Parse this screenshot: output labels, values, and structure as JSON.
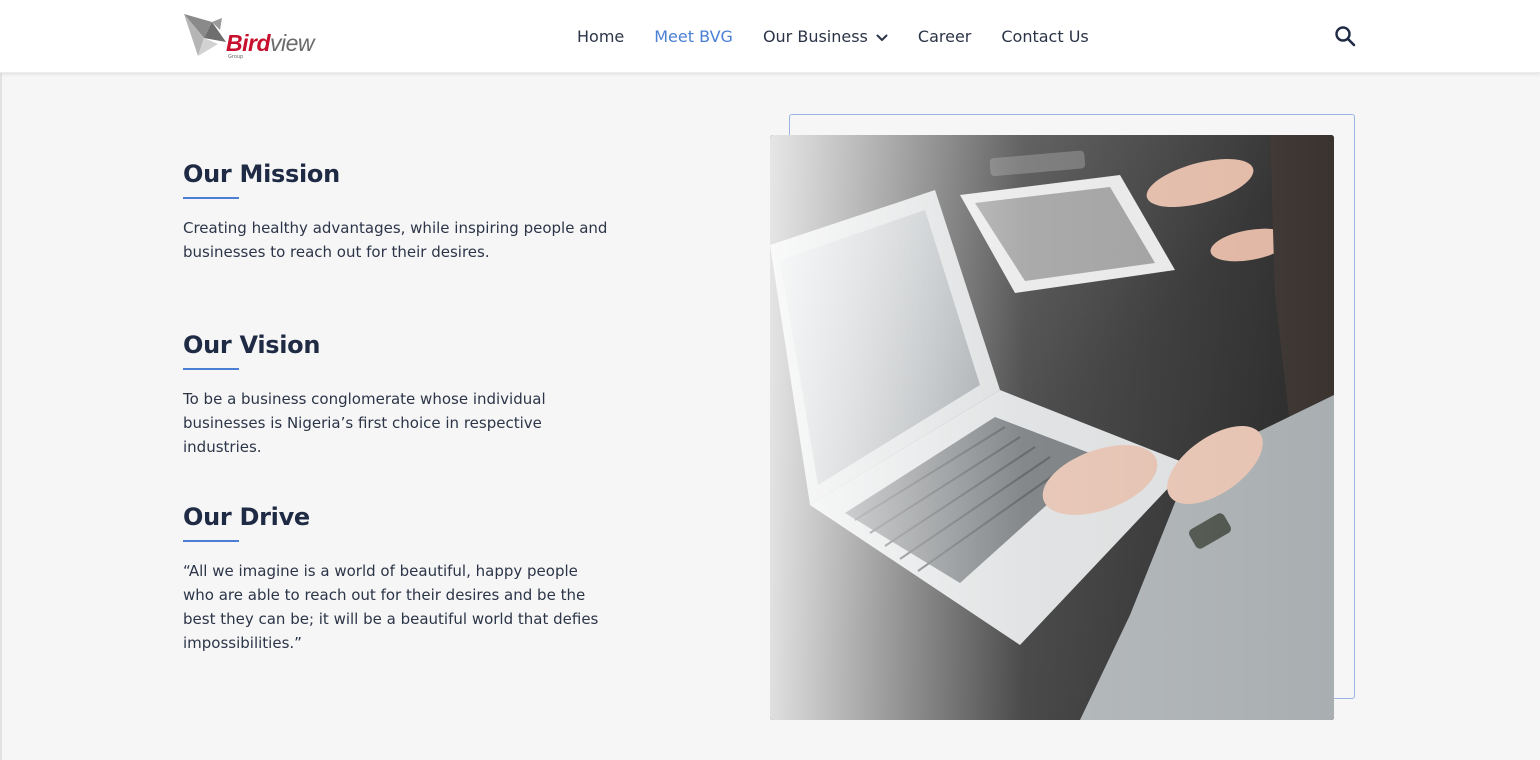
{
  "brand": {
    "logo_text_primary": "Bird",
    "logo_text_secondary": "view",
    "logo_subtext": "Group",
    "colors": {
      "red": "#c8102e",
      "accent": "#4a7fd4",
      "heading": "#1f2a44"
    }
  },
  "nav": {
    "items": [
      {
        "label": "Home",
        "active": false
      },
      {
        "label": "Meet BVG",
        "active": true
      },
      {
        "label": "Our Business",
        "active": false,
        "dropdown": true
      },
      {
        "label": "Career",
        "active": false
      },
      {
        "label": "Contact Us",
        "active": false
      }
    ],
    "search_icon": "search-icon"
  },
  "content": {
    "mission": {
      "title": "Our Mission",
      "text": "Creating healthy advantages, while inspiring people and businesses to reach out for their desires."
    },
    "vision": {
      "title": "Our Vision",
      "text": "To be a business conglomerate whose individual businesses is Nigeria’s first choice in respective industries."
    },
    "drive": {
      "title": "Our Drive",
      "text": "“All we imagine is a world of beautiful, happy people who are able to reach out for their desires and be the best they can be; it will be a beautiful world that defies impossibilities.”"
    }
  }
}
